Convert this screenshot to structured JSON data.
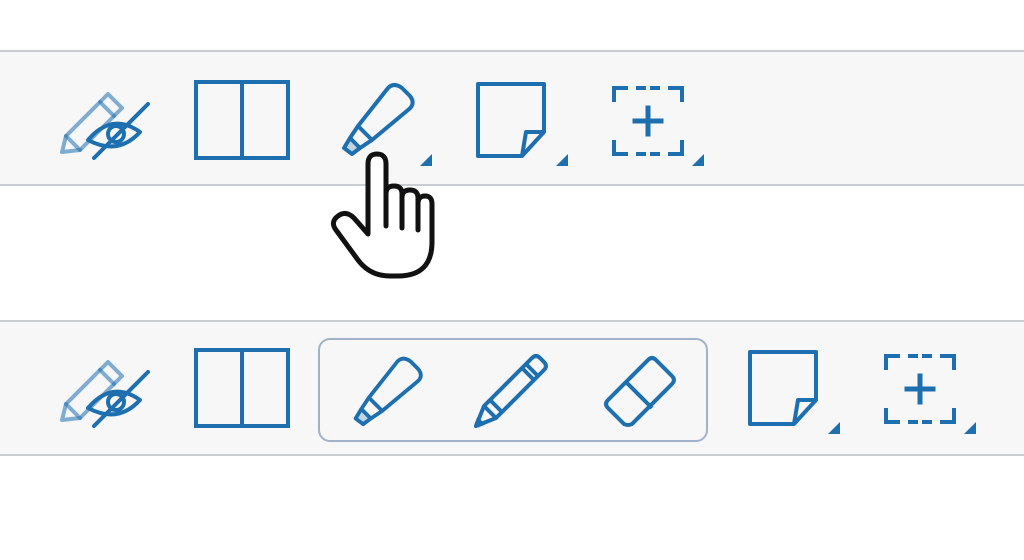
{
  "colors": {
    "icon_blue": "#1e6fb0",
    "toolbar_background": "#f7f7f7",
    "toolbar_border": "#c9cdd2",
    "group_border": "#9fb2c7"
  },
  "toolbar_top": {
    "tools": [
      {
        "icon": "hide-annotations-icon",
        "has_dropdown": false
      },
      {
        "icon": "two-page-view-icon",
        "has_dropdown": false
      },
      {
        "icon": "highlighter-icon",
        "has_dropdown": true
      },
      {
        "icon": "sticky-note-icon",
        "has_dropdown": true
      },
      {
        "icon": "area-selection-icon",
        "has_dropdown": true
      }
    ],
    "cursor": {
      "icon": "hand-pointer-icon",
      "hovering": "highlighter-icon"
    }
  },
  "toolbar_bottom": {
    "tools": [
      {
        "icon": "hide-annotations-icon",
        "has_dropdown": false
      },
      {
        "icon": "two-page-view-icon",
        "has_dropdown": false
      },
      {
        "icon": "sticky-note-icon",
        "has_dropdown": true
      },
      {
        "icon": "area-selection-icon",
        "has_dropdown": true
      }
    ],
    "expanded_group": {
      "tools": [
        {
          "icon": "highlighter-icon"
        },
        {
          "icon": "pencil-icon"
        },
        {
          "icon": "eraser-icon"
        }
      ]
    }
  }
}
